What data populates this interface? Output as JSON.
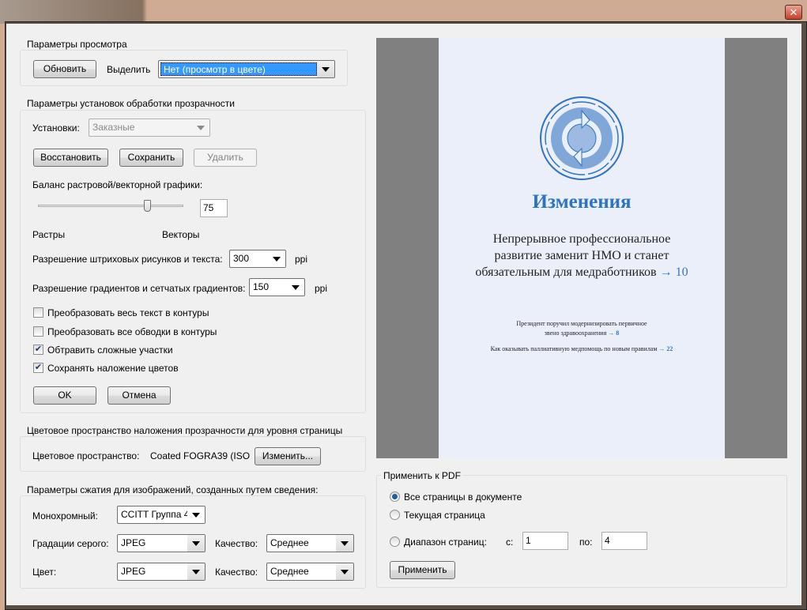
{
  "window": {
    "close_label": "✕"
  },
  "view": {
    "legend": "Параметры просмотра",
    "refresh": "Обновить",
    "highlight_label": "Выделить",
    "highlight_value": "Нет (просмотр в цвете)"
  },
  "preset": {
    "legend": "Параметры установок обработки прозрачности",
    "preset_label": "Установки:",
    "preset_value": "Заказные",
    "restore": "Восстановить",
    "save": "Сохранить",
    "delete": "Удалить",
    "balance_label": "Баланс растровой/векторной графики:",
    "balance_value": "75",
    "balance_percent": 75,
    "raster": "Растры",
    "vector": "Векторы",
    "line_res_label": "Разрешение штриховых рисунков и текста:",
    "line_res_value": "300",
    "gradient_res_label": "Разрешение градиентов и сетчатых градиентов:",
    "gradient_res_value": "150",
    "ppi": "ppi",
    "checkboxes": [
      {
        "label": "Преобразовать весь текст в контуры",
        "checked": false
      },
      {
        "label": "Преобразовать все обводки в контуры",
        "checked": false
      },
      {
        "label": "Обтравить сложные участки",
        "checked": true
      },
      {
        "label": "Сохранять наложение цветов",
        "checked": true
      }
    ],
    "ok": "OK",
    "cancel": "Отмена"
  },
  "colorspace": {
    "legend": "Цветовое пространство наложения прозрачности для уровня страницы",
    "label": "Цветовое пространство:",
    "value": "Coated FOGRA39 (ISO",
    "change": "Изменить..."
  },
  "compression": {
    "legend": "Параметры сжатия для изображений, созданных путем сведения:",
    "mono_label": "Монохромный:",
    "mono_value": "CCITT Группа 4",
    "gray_label": "Градации серого:",
    "gray_value": "JPEG",
    "quality_label": "Качество:",
    "gray_quality": "Среднее",
    "color_label": "Цвет:",
    "color_value": "JPEG",
    "color_quality": "Среднее"
  },
  "preview": {
    "title": "Изменения",
    "subtitle_lines": [
      "Непрерывное профессиональное",
      "развитие заменит НМО и станет",
      "обязательным для медработников"
    ],
    "subtitle_ref": "→ 10",
    "item1_lines": [
      "Президент поручил модернизировать первичное",
      "звено здравоохранения"
    ],
    "item1_ref": "→ 8",
    "item2": "Как оказывать паллиативную медпомощь по новым правилам",
    "item2_ref": "→ 22",
    "accent": "#2f74c0"
  },
  "apply": {
    "legend": "Применить к PDF",
    "all_pages": "Все страницы в документе",
    "current_page": "Текущая страница",
    "range": "Диапазон страниц:",
    "from_label": "с:",
    "from_value": "1",
    "to_label": "по:",
    "to_value": "4",
    "apply": "Применить",
    "selected": "all_pages"
  }
}
